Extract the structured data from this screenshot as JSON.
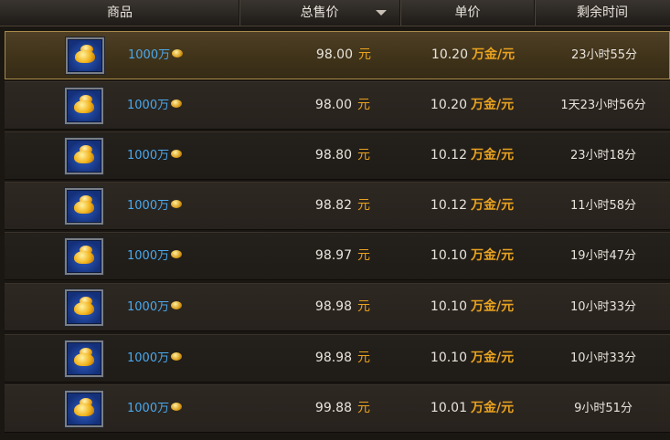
{
  "header": {
    "col_item": "商品",
    "col_total": "总售价",
    "col_unit": "单价",
    "col_time": "剩余时间"
  },
  "rows": [
    {
      "name": "1000万",
      "total": "98.00",
      "total_unit": "元",
      "price": "10.20",
      "price_unit": "万金/元",
      "time": "23小时55分",
      "selected": true
    },
    {
      "name": "1000万",
      "total": "98.00",
      "total_unit": "元",
      "price": "10.20",
      "price_unit": "万金/元",
      "time": "1天23小时56分",
      "selected": false
    },
    {
      "name": "1000万",
      "total": "98.80",
      "total_unit": "元",
      "price": "10.12",
      "price_unit": "万金/元",
      "time": "23小时18分",
      "selected": false
    },
    {
      "name": "1000万",
      "total": "98.82",
      "total_unit": "元",
      "price": "10.12",
      "price_unit": "万金/元",
      "time": "11小时58分",
      "selected": false
    },
    {
      "name": "1000万",
      "total": "98.97",
      "total_unit": "元",
      "price": "10.10",
      "price_unit": "万金/元",
      "time": "19小时47分",
      "selected": false
    },
    {
      "name": "1000万",
      "total": "98.98",
      "total_unit": "元",
      "price": "10.10",
      "price_unit": "万金/元",
      "time": "10小时33分",
      "selected": false
    },
    {
      "name": "1000万",
      "total": "98.98",
      "total_unit": "元",
      "price": "10.10",
      "price_unit": "万金/元",
      "time": "10小时33分",
      "selected": false
    },
    {
      "name": "1000万",
      "total": "99.88",
      "total_unit": "元",
      "price": "10.01",
      "price_unit": "万金/元",
      "time": "9小时51分",
      "selected": false
    }
  ],
  "icons": {
    "item": "gold-ingot-icon",
    "coin": "gold-coin-icon",
    "sort": "sort-descending-icon"
  },
  "colors": {
    "name": "#4aa8ec",
    "unit": "#e8a21e",
    "selected_border": "#a88a4a"
  }
}
